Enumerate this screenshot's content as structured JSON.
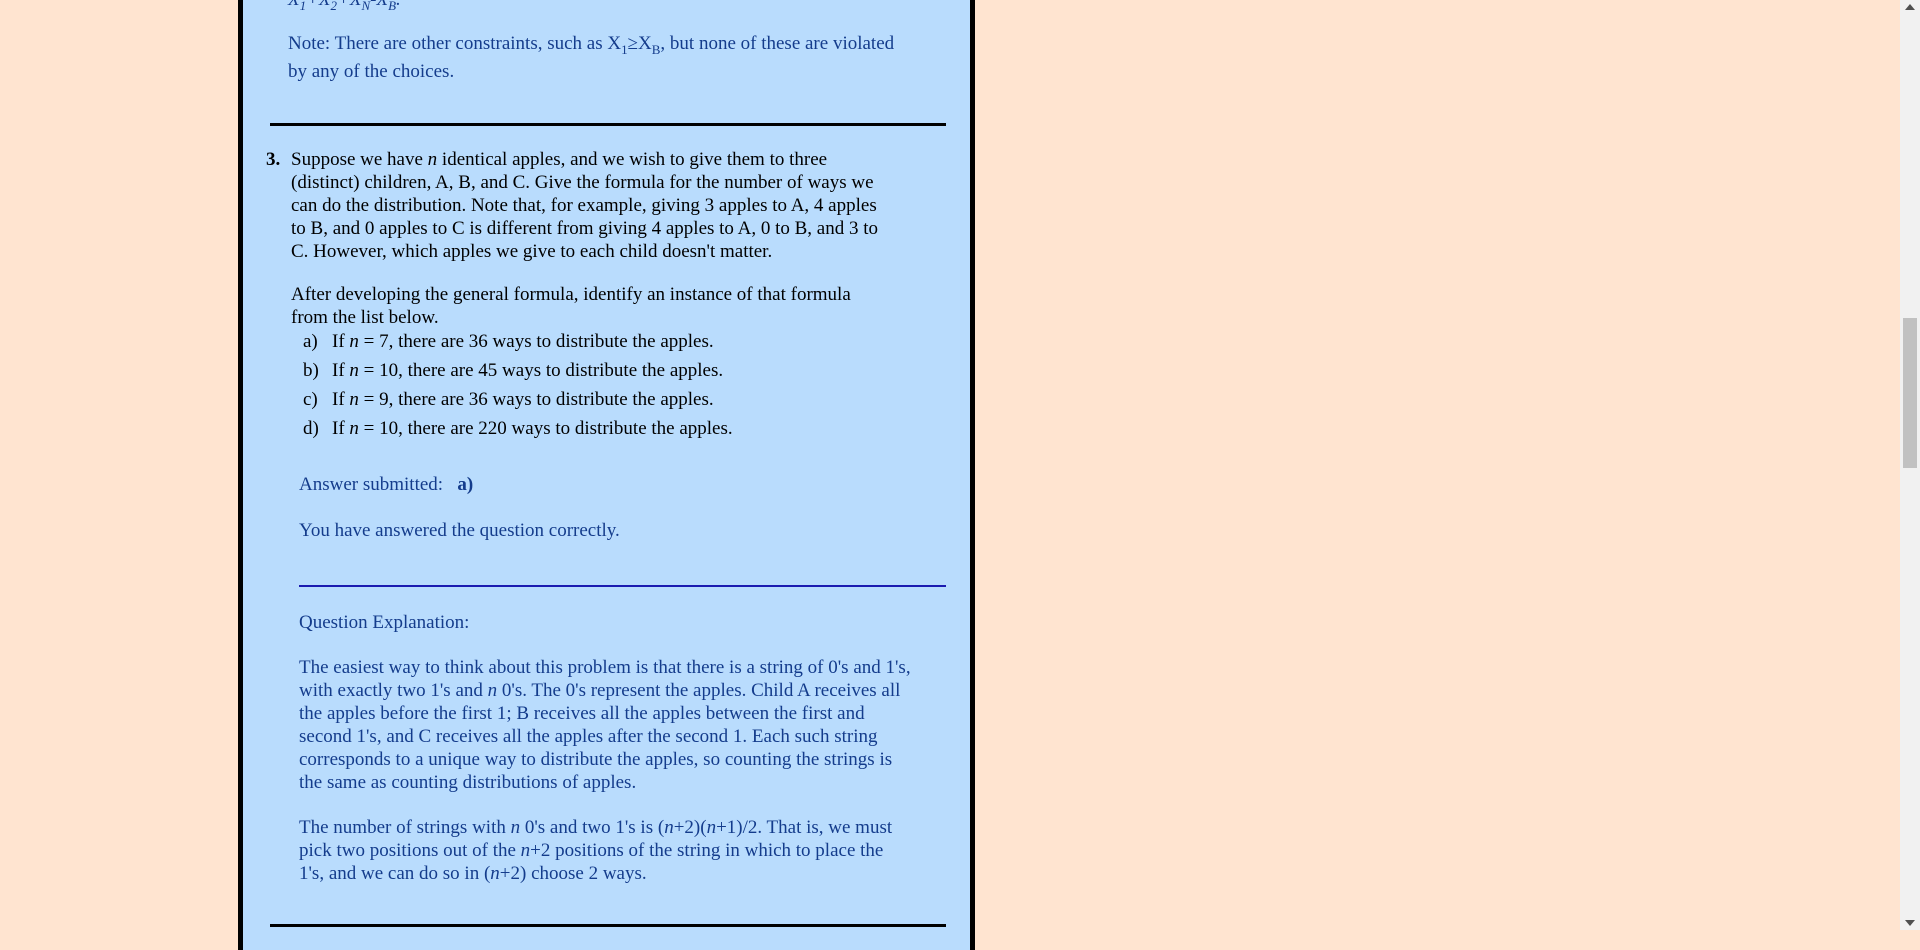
{
  "prev": {
    "formula_parts": [
      "X",
      "1",
      "+X",
      "2",
      "+X",
      "N",
      "-X",
      "B",
      "."
    ],
    "note_prefix": "Note: There are other constraints, such as X",
    "note_sub1": "1",
    "note_ge": "≥X",
    "note_sub2": "B",
    "note_suffix": ", but none of these are violated",
    "note_line2": "by any of the choices."
  },
  "question": {
    "number": "3.",
    "text_lines": [
      "Suppose we have n identical apples, and we wish to give them to three",
      "(distinct) children, A, B, and C. Give the formula for the number of ways we",
      "can do the distribution. Note that, for example, giving 3 apples to A, 4 apples",
      "to B, and 0 apples to C is different from giving 4 apples to A, 0 to B, and 3 to",
      "C. However, which apples we give to each child doesn't matter."
    ],
    "after_lines": [
      "After developing the general formula, identify an instance of that formula",
      "from the list below."
    ],
    "choices": [
      {
        "label": "a)",
        "pre": "If ",
        "var": "n",
        "post": " = 7, there are 36 ways to distribute the apples."
      },
      {
        "label": "b)",
        "pre": "If ",
        "var": "n",
        "post": " = 10, there are 45 ways to distribute the apples."
      },
      {
        "label": "c)",
        "pre": "If ",
        "var": "n",
        "post": " = 9, there are 36 ways to distribute the apples."
      },
      {
        "label": "d)",
        "pre": "If ",
        "var": "n",
        "post": " = 10, there are 220 ways to distribute the apples."
      }
    ]
  },
  "result": {
    "submitted_label": "Answer submitted:",
    "submitted_value": "a)",
    "feedback": "You have answered the question correctly."
  },
  "explanation": {
    "heading": "Question Explanation:",
    "para1_lines": [
      "The easiest way to think about this problem is that there is a string of 0's and 1's,",
      "with exactly two 1's and n 0's. The 0's represent the apples. Child A receives all",
      "the apples before the first 1; B receives all the apples between the first and",
      "second 1's, and C receives all the apples after the second 1. Each such string",
      "corresponds to a unique way to distribute the apples, so counting the strings is",
      "the same as counting distributions of apples."
    ],
    "para2_lines": [
      "The number of strings with n 0's and two 1's is (n+2)(n+1)/2. That is, we must",
      "pick two positions out of the n+2 positions of the string in which to place the",
      "1's, and we can do so in (n+2) choose 2 ways."
    ]
  }
}
